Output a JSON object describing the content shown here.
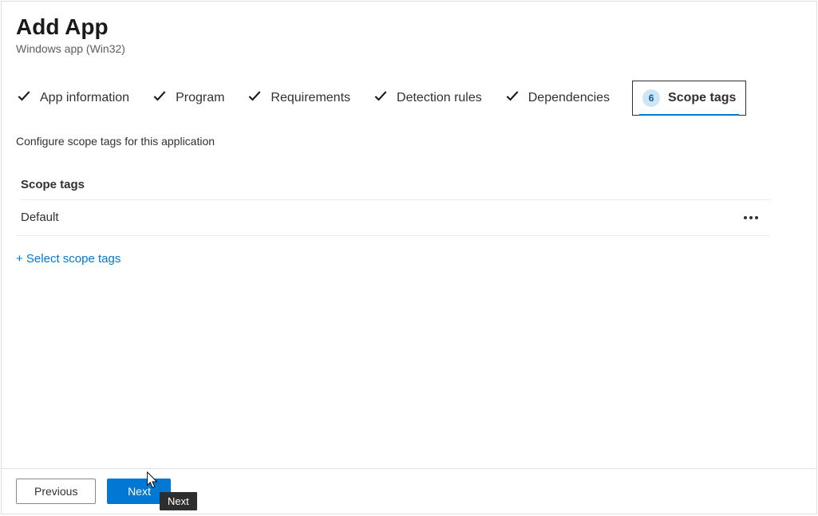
{
  "header": {
    "title": "Add App",
    "subtitle": "Windows app (Win32)"
  },
  "stepper": {
    "steps": [
      {
        "label": "App information",
        "done": true
      },
      {
        "label": "Program",
        "done": true
      },
      {
        "label": "Requirements",
        "done": true
      },
      {
        "label": "Detection rules",
        "done": true
      },
      {
        "label": "Dependencies",
        "done": true
      }
    ],
    "current": {
      "number": "6",
      "label": "Scope tags"
    }
  },
  "main": {
    "description": "Configure scope tags for this application",
    "section_heading": "Scope tags",
    "tags": [
      {
        "name": "Default"
      }
    ],
    "select_link": "+ Select scope tags"
  },
  "footer": {
    "previous": "Previous",
    "next": "Next",
    "tooltip": "Next"
  }
}
